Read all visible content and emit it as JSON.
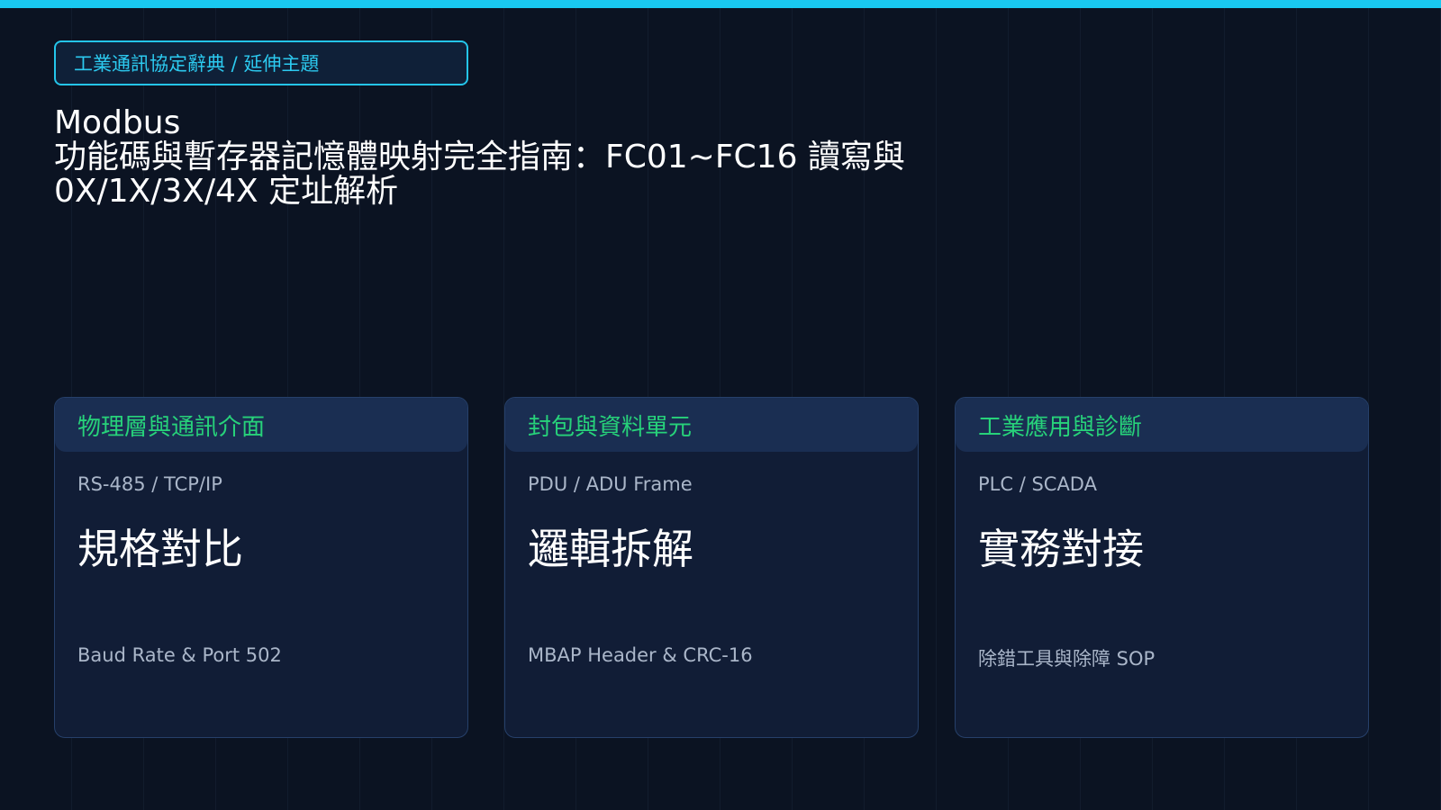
{
  "colors": {
    "background": "#0b1322",
    "accent_bar": "#19c8f0",
    "tag_border": "#24c5ea",
    "card_heading": "#27d27a",
    "card_background": "#111d36",
    "card_header_background": "#1a2e52",
    "muted_text": "#aab6c9"
  },
  "header": {
    "tag": "工業通訊協定辭典 / 延伸主題",
    "title_lines": [
      "Modbus",
      "功能碼與暫存器記憶體映射完全指南：FC01~FC16 讀寫與",
      "0X/1X/3X/4X 定址解析"
    ]
  },
  "cards": [
    {
      "heading": "物理層與通訊介面",
      "subtitle": "RS-485 / TCP/IP",
      "headline": "規格對比",
      "footer": "Baud Rate & Port 502"
    },
    {
      "heading": "封包與資料單元",
      "subtitle": "PDU / ADU Frame",
      "headline": "邏輯拆解",
      "footer": "MBAP Header & CRC-16"
    },
    {
      "heading": "工業應用與診斷",
      "subtitle": "PLC / SCADA",
      "headline": "實務對接",
      "footer": "除錯工具與除障 SOP"
    }
  ]
}
